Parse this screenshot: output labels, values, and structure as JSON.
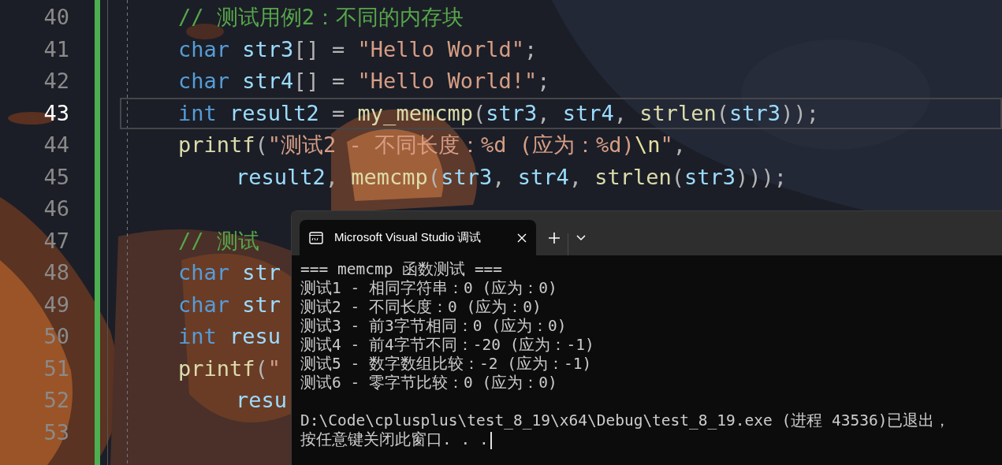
{
  "editor": {
    "lines": [
      {
        "number": "40",
        "current": false,
        "wrapped": false,
        "tokens": [
          {
            "kind": "comment",
            "text": "// 测试用例2：不同的内存块"
          }
        ]
      },
      {
        "number": "41",
        "current": false,
        "wrapped": false,
        "tokens": [
          {
            "kind": "keyword",
            "text": "char "
          },
          {
            "kind": "variable",
            "text": "str3"
          },
          {
            "kind": "punct",
            "text": "[] = "
          },
          {
            "kind": "string",
            "text": "\"Hello World\""
          },
          {
            "kind": "punct",
            "text": ";"
          }
        ]
      },
      {
        "number": "42",
        "current": false,
        "wrapped": false,
        "tokens": [
          {
            "kind": "keyword",
            "text": "char "
          },
          {
            "kind": "variable",
            "text": "str4"
          },
          {
            "kind": "punct",
            "text": "[] = "
          },
          {
            "kind": "string",
            "text": "\"Hello World!\""
          },
          {
            "kind": "punct",
            "text": ";"
          }
        ]
      },
      {
        "number": "43",
        "current": true,
        "wrapped": false,
        "tokens": [
          {
            "kind": "keyword",
            "text": "int "
          },
          {
            "kind": "variable",
            "text": "result2"
          },
          {
            "kind": "punct",
            "text": " = "
          },
          {
            "kind": "function",
            "text": "my_memcmp"
          },
          {
            "kind": "punct",
            "text": "("
          },
          {
            "kind": "variable",
            "text": "str3"
          },
          {
            "kind": "punct",
            "text": ", "
          },
          {
            "kind": "variable",
            "text": "str4"
          },
          {
            "kind": "punct",
            "text": ", "
          },
          {
            "kind": "function",
            "text": "strlen"
          },
          {
            "kind": "punct",
            "text": "("
          },
          {
            "kind": "variable",
            "text": "str3"
          },
          {
            "kind": "punct",
            "text": "));"
          }
        ]
      },
      {
        "number": "44",
        "current": false,
        "wrapped": false,
        "tokens": [
          {
            "kind": "function",
            "text": "printf"
          },
          {
            "kind": "punct",
            "text": "("
          },
          {
            "kind": "string",
            "text": "\"测试2 - 不同长度：%d (应为：%d)"
          },
          {
            "kind": "escape",
            "text": "\\n"
          },
          {
            "kind": "string",
            "text": "\""
          },
          {
            "kind": "punct",
            "text": ","
          }
        ]
      },
      {
        "number": "45",
        "current": false,
        "wrapped": true,
        "tokens": [
          {
            "kind": "variable",
            "text": "result2"
          },
          {
            "kind": "punct",
            "text": ", "
          },
          {
            "kind": "function",
            "text": "memcmp"
          },
          {
            "kind": "punct",
            "text": "("
          },
          {
            "kind": "variable",
            "text": "str3"
          },
          {
            "kind": "punct",
            "text": ", "
          },
          {
            "kind": "variable",
            "text": "str4"
          },
          {
            "kind": "punct",
            "text": ", "
          },
          {
            "kind": "function",
            "text": "strlen"
          },
          {
            "kind": "punct",
            "text": "("
          },
          {
            "kind": "variable",
            "text": "str3"
          },
          {
            "kind": "punct",
            "text": ")));"
          }
        ]
      },
      {
        "number": "46",
        "current": false
      },
      {
        "number": "47",
        "current": false,
        "wrapped": false,
        "tokens": [
          {
            "kind": "comment",
            "text": "// 测试"
          }
        ]
      },
      {
        "number": "48",
        "current": false,
        "wrapped": false,
        "tokens": [
          {
            "kind": "keyword",
            "text": "char "
          },
          {
            "kind": "variable",
            "text": "str"
          }
        ]
      },
      {
        "number": "49",
        "current": false,
        "wrapped": false,
        "tokens": [
          {
            "kind": "keyword",
            "text": "char "
          },
          {
            "kind": "variable",
            "text": "str"
          }
        ]
      },
      {
        "number": "50",
        "current": false,
        "wrapped": false,
        "tokens": [
          {
            "kind": "keyword",
            "text": "int "
          },
          {
            "kind": "variable",
            "text": "resu"
          }
        ]
      },
      {
        "number": "51",
        "current": false,
        "wrapped": false,
        "tokens": [
          {
            "kind": "function",
            "text": "printf"
          },
          {
            "kind": "punct",
            "text": "("
          },
          {
            "kind": "string",
            "text": "\""
          }
        ]
      },
      {
        "number": "52",
        "current": false,
        "wrapped": true,
        "tokens": [
          {
            "kind": "variable",
            "text": "resu"
          }
        ]
      },
      {
        "number": "53",
        "current": false
      }
    ]
  },
  "console": {
    "tab": {
      "title": "Microsoft Visual Studio 调试",
      "selected": true
    },
    "blocks": [
      [
        "=== memcmp 函数测试 ===",
        "测试1 - 相同字符串：0 (应为：0)",
        "测试2 - 不同长度：0 (应为：0)",
        "测试3 - 前3字节相同：0 (应为：0)",
        "测试4 - 前4字节不同：-20 (应为：-1)",
        "测试5 - 数字数组比较：-2 (应为：-1)",
        "测试6 - 零字节比较：0 (应为：0)"
      ],
      [
        "D:\\Code\\cplusplus\\test_8_19\\x64\\Debug\\test_8_19.exe (进程 43536)已退出，",
        "按任意键关闭此窗口. . ."
      ]
    ]
  }
}
